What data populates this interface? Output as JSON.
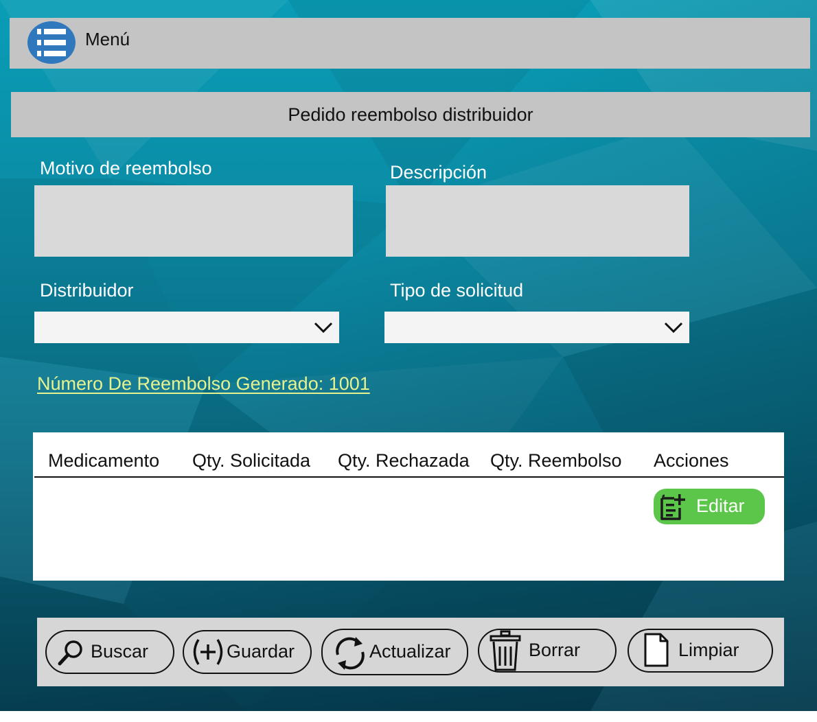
{
  "menu": {
    "label": "Menú",
    "icon": "list-menu-icon"
  },
  "page": {
    "title": "Pedido reembolso distribuidor"
  },
  "form": {
    "reason_label": "Motivo de reembolso",
    "reason_value": "",
    "description_label": "Descripción",
    "description_value": "",
    "distributor_label": "Distribuidor",
    "distributor_value": "",
    "request_type_label": "Tipo de solicitud",
    "request_type_value": ""
  },
  "refund_number_text": "Número De Reembolso Generado: 1001",
  "table": {
    "columns": [
      "Medicamento",
      "Qty. Solicitada",
      "Qty. Rechazada",
      "Qty. Reembolso",
      "Acciones"
    ],
    "edit_label": "Editar"
  },
  "actions": {
    "search_label": "Buscar",
    "save_label": "Guardar",
    "update_label": "Actualizar",
    "delete_label": "Borrar",
    "clear_label": "Limpiar"
  },
  "colors": {
    "bar_gray": "#c4c4c4",
    "menu_icon_blue": "#2f78bd",
    "link_yellow": "#e6f28f",
    "edit_green": "#5cc64a",
    "background_teal": "#0a8aa5"
  }
}
